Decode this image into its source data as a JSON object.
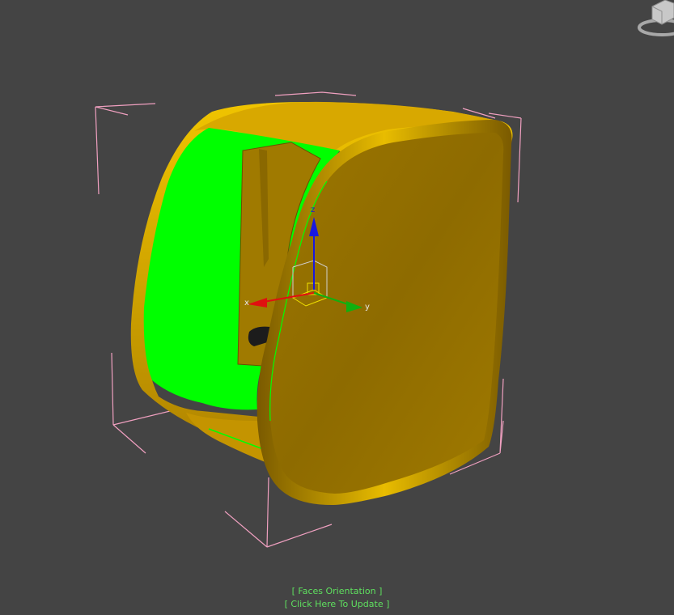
{
  "viewport": {
    "status_label": "[ Faces Orientation ]",
    "update_label": "[ Click Here To Update ]",
    "status_color": "#5fe05f"
  },
  "gizmo": {
    "x_label": "x",
    "y_label": "y",
    "z_label": "z",
    "x_color": "#e01010",
    "y_color": "#10b010",
    "z_color": "#1818e0"
  },
  "colors": {
    "background": "#444444",
    "object_fill": "#c89600",
    "object_dark": "#8c6600",
    "interior_face": "#00ff00",
    "bounding_box": "#f0a0c0"
  }
}
